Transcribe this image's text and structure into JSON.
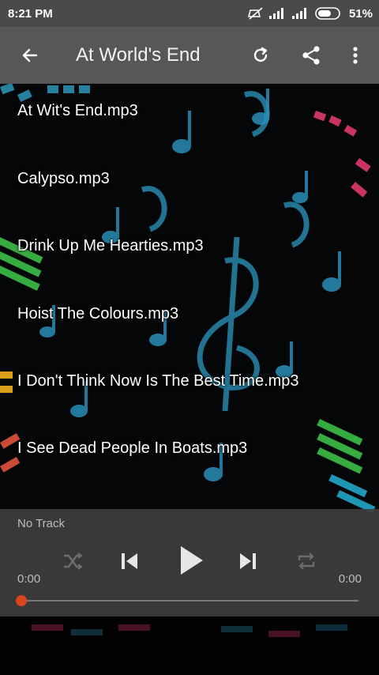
{
  "status": {
    "time": "8:21 PM",
    "battery": "51%"
  },
  "toolbar": {
    "title": "At World's End",
    "back_icon": "arrow-left-icon",
    "refresh_icon": "refresh-icon",
    "share_icon": "share-icon",
    "more_icon": "more-vert-icon"
  },
  "tracks": [
    "At Wit's End.mp3",
    "Calypso.mp3",
    "Drink Up Me Hearties.mp3",
    "Hoist The Colours.mp3",
    "I Don't Think Now Is The Best Time.mp3",
    "I See Dead People In Boats.mp3"
  ],
  "player": {
    "now_playing": "No Track",
    "time_elapsed": "0:00",
    "time_total": "0:00",
    "progress": 0,
    "accent": "#d8451e"
  }
}
